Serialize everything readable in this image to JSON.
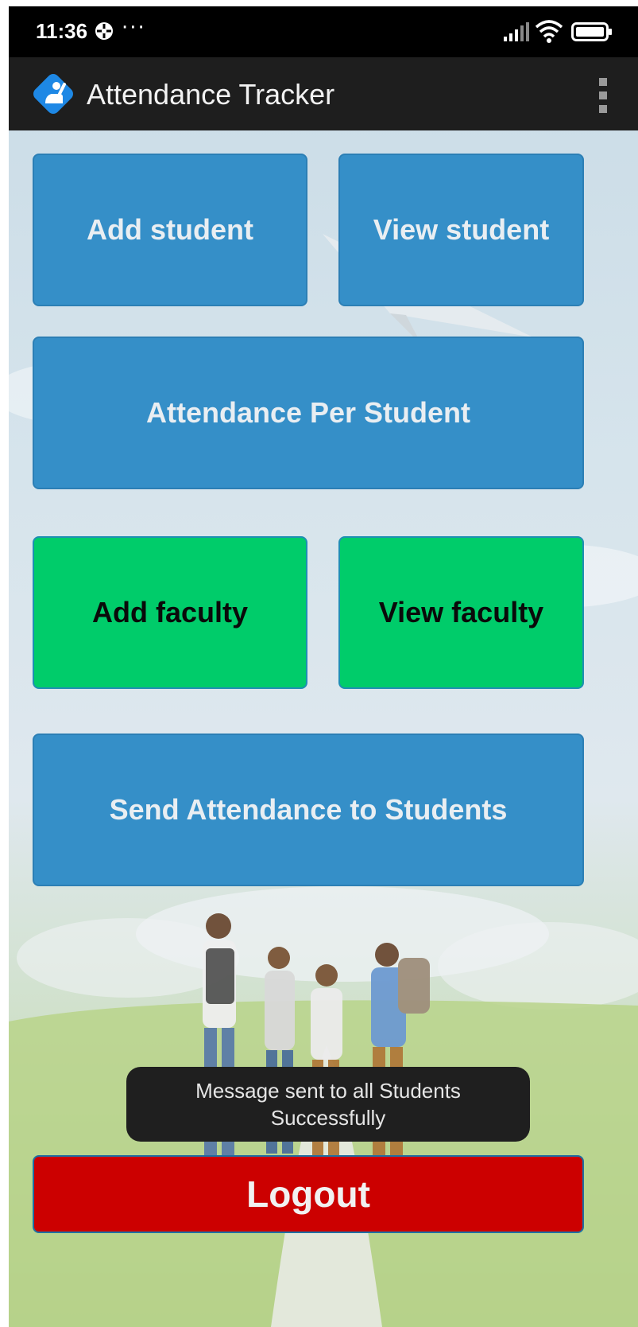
{
  "status_bar": {
    "time": "11:36",
    "dots": "···",
    "icons": [
      "vpn-icon",
      "signal-icon",
      "wifi-icon",
      "battery-icon"
    ]
  },
  "app_bar": {
    "title": "Attendance Tracker",
    "logo_icon": "hand-raise-icon",
    "menu_icon": "overflow-menu-icon"
  },
  "buttons": {
    "add_student": "Add student",
    "view_student": "View student",
    "attendance_per_student": "Attendance Per Student",
    "add_faculty": "Add faculty",
    "view_faculty": "View faculty",
    "send_attendance": "Send Attendance to Students",
    "logout": "Logout"
  },
  "toast": {
    "message": "Message sent to all Students Successfully"
  },
  "colors": {
    "primary_button": "#358fc8",
    "faculty_button": "#00cc6a",
    "logout_button": "#cc0000",
    "app_bar": "#1e1e1e",
    "status_bar": "#000000",
    "logo": "#1e88e5"
  }
}
